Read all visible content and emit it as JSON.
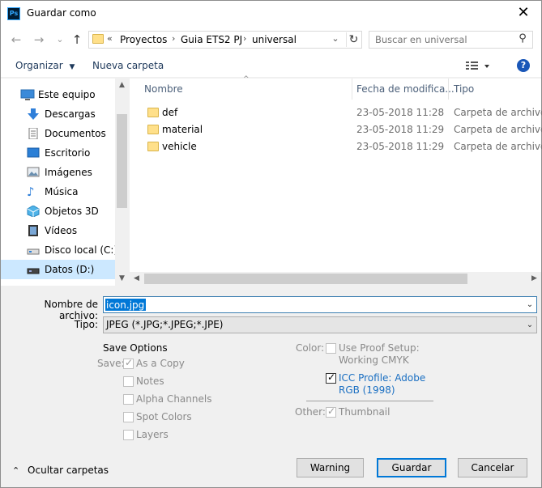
{
  "window": {
    "title": "Guardar como",
    "app_icon": "Ps"
  },
  "nav": {
    "back": "←",
    "forward": "→",
    "recent": "⌄",
    "up": "↑",
    "breadcrumb": [
      "Proyectos",
      "Guia ETS2 PJ",
      "universal"
    ],
    "overflow": "«"
  },
  "search": {
    "placeholder": "Buscar en universal"
  },
  "toolbar": {
    "organize": "Organizar",
    "new_folder": "Nueva carpeta",
    "help": "?"
  },
  "sidebar": {
    "items": [
      {
        "label": "Este equipo",
        "icon": "computer-icon"
      },
      {
        "label": "Descargas",
        "icon": "download-icon"
      },
      {
        "label": "Documentos",
        "icon": "document-icon"
      },
      {
        "label": "Escritorio",
        "icon": "desktop-icon"
      },
      {
        "label": "Imágenes",
        "icon": "pictures-icon"
      },
      {
        "label": "Música",
        "icon": "music-icon"
      },
      {
        "label": "Objetos 3D",
        "icon": "objects3d-icon"
      },
      {
        "label": "Vídeos",
        "icon": "video-icon"
      },
      {
        "label": "Disco local (C:)",
        "icon": "drive-icon"
      },
      {
        "label": "Datos (D:)",
        "icon": "drive-icon"
      }
    ]
  },
  "files": {
    "columns": {
      "name": "Nombre",
      "date": "Fecha de modifica...",
      "type": "Tipo"
    },
    "rows": [
      {
        "name": "def",
        "date": "23-05-2018 11:28",
        "type": "Carpeta de archivos"
      },
      {
        "name": "material",
        "date": "23-05-2018 11:29",
        "type": "Carpeta de archivos"
      },
      {
        "name": "vehicle",
        "date": "23-05-2018 11:29",
        "type": "Carpeta de archivos"
      }
    ]
  },
  "form": {
    "filename_label": "Nombre de archivo:",
    "filename_value": "icon.jpg",
    "type_label": "Tipo:",
    "type_value": "JPEG (*.JPG;*.JPEG;*.JPE)"
  },
  "save_options": {
    "heading": "Save Options",
    "save_label": "Save:",
    "as_copy": "As a Copy",
    "notes": "Notes",
    "alpha": "Alpha Channels",
    "spot": "Spot Colors",
    "layers": "Layers",
    "color_label": "Color:",
    "proof_line1": "Use Proof Setup:",
    "proof_line2": "Working CMYK",
    "icc_line1": "ICC Profile:  Adobe",
    "icc_line2": "RGB (1998)",
    "other_label": "Other:",
    "thumbnail": "Thumbnail"
  },
  "footer": {
    "hide_folders": "Ocultar carpetas",
    "warning": "Warning",
    "save": "Guardar",
    "cancel": "Cancelar"
  }
}
